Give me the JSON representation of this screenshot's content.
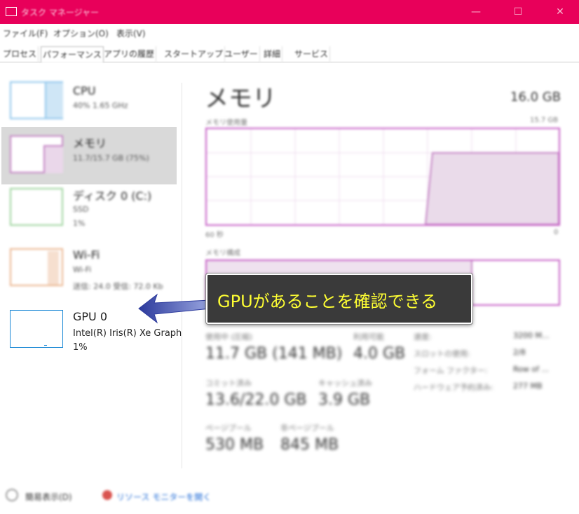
{
  "window": {
    "title": "タスク マネージャー",
    "minimize": "—",
    "maximize": "☐",
    "close": "✕"
  },
  "menu": [
    "ファイル(F)",
    "オプション(O)",
    "表示(V)"
  ],
  "tabs": [
    "プロセス",
    "パフォーマンス",
    "アプリの履歴",
    "スタートアップ",
    "ユーザー",
    "詳細",
    "サービス"
  ],
  "sidebar": {
    "cpu": {
      "title": "CPU",
      "sub": "40% 1.65 GHz",
      "color": "#1e8ad6"
    },
    "memory": {
      "title": "メモリ",
      "sub": "11.7/15.7 GB (75%)",
      "color": "#b46ab4"
    },
    "disk": {
      "title": "ディスク 0 (C:)",
      "sub1": "SSD",
      "sub2": "1%",
      "color": "#5cb85c"
    },
    "wifi": {
      "title": "Wi-Fi",
      "sub1": "Wi-Fi",
      "sub2": "送信: 24.0 受信: 72.0 Kb",
      "color": "#d9884a"
    },
    "gpu": {
      "title": "GPU 0",
      "sub1": "Intel(R) Iris(R) Xe Graph",
      "sub2": "1%",
      "color": "#1e8ad6"
    }
  },
  "main": {
    "title": "メモリ",
    "total": "16.0 GB",
    "usage_label": "メモリ使用量",
    "usage_max": "15.7 GB",
    "time_label": "60 秒",
    "time_end": "0",
    "composition_label": "メモリ構成",
    "memory_fraction": 0.75,
    "stats": {
      "in_use_label": "使用中 (圧縮)",
      "in_use_value": "11.7 GB (141 MB)",
      "available_label": "利用可能",
      "available_value": "4.0 GB",
      "committed_label": "コミット済み",
      "committed_value": "13.6/22.0 GB",
      "cached_label": "キャッシュ済み",
      "cached_value": "3.9 GB",
      "paged_label": "ページプール",
      "paged_value": "530 MB",
      "nonpaged_label": "非ページプール",
      "nonpaged_value": "845 MB"
    },
    "details": [
      {
        "key": "速度:",
        "value": "3200 M..."
      },
      {
        "key": "スロットの使用:",
        "value": "2/8"
      },
      {
        "key": "フォーム ファクター:",
        "value": "Row of ..."
      },
      {
        "key": "ハードウェア予約済み:",
        "value": "277 MB"
      }
    ]
  },
  "callout": {
    "text": "GPUがあることを確認できる"
  },
  "footer": {
    "fewer_details": "簡易表示(D)",
    "resource_monitor": "リソース モニターを開く"
  }
}
